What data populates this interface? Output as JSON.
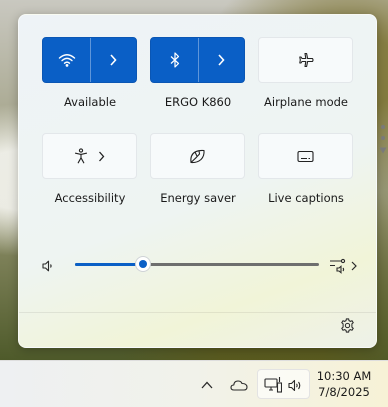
{
  "quick_settings": {
    "tiles": [
      {
        "label": "Available",
        "icon": "wifi-icon",
        "state": "on"
      },
      {
        "label": "ERGO K860",
        "icon": "bluetooth-icon",
        "state": "on"
      },
      {
        "label": "Airplane mode",
        "icon": "airplane-icon",
        "state": "off"
      },
      {
        "label": "Accessibility",
        "icon": "accessibility-icon",
        "state": "off"
      },
      {
        "label": "Energy saver",
        "icon": "leaf-icon",
        "state": "off"
      },
      {
        "label": "Live captions",
        "icon": "captions-icon",
        "state": "off"
      }
    ],
    "volume": {
      "level_percent": 28,
      "icon": "speaker-icon",
      "output_icon": "audio-output-icon"
    },
    "settings_icon": "gear-icon"
  },
  "taskbar": {
    "time": "10:30 AM",
    "date": "7/8/2025",
    "icons": [
      "chevron-up-icon",
      "onedrive-cloud-icon",
      "network-icon",
      "volume-icon"
    ]
  },
  "colors": {
    "accent": "#0a5fc6",
    "panel": "#eef3f7"
  }
}
